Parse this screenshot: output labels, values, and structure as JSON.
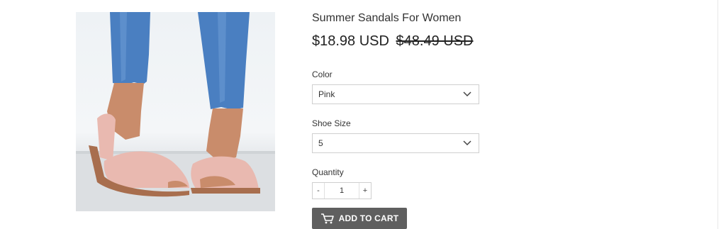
{
  "product": {
    "title": "Summer Sandals For Women",
    "price_sale": "$18.98 USD",
    "price_compare": "$48.49 USD"
  },
  "options": [
    {
      "label": "Color",
      "selected": "Pink"
    },
    {
      "label": "Shoe Size",
      "selected": "5"
    }
  ],
  "quantity": {
    "label": "Quantity",
    "minus": "-",
    "value": "1",
    "plus": "+"
  },
  "cart_button": {
    "label": "ADD TO CART",
    "icon": "cart-icon"
  },
  "colors": {
    "button_bg": "#5f5f5f",
    "jeans": "#4a7fc1",
    "sandal": "#e9b9b0"
  }
}
